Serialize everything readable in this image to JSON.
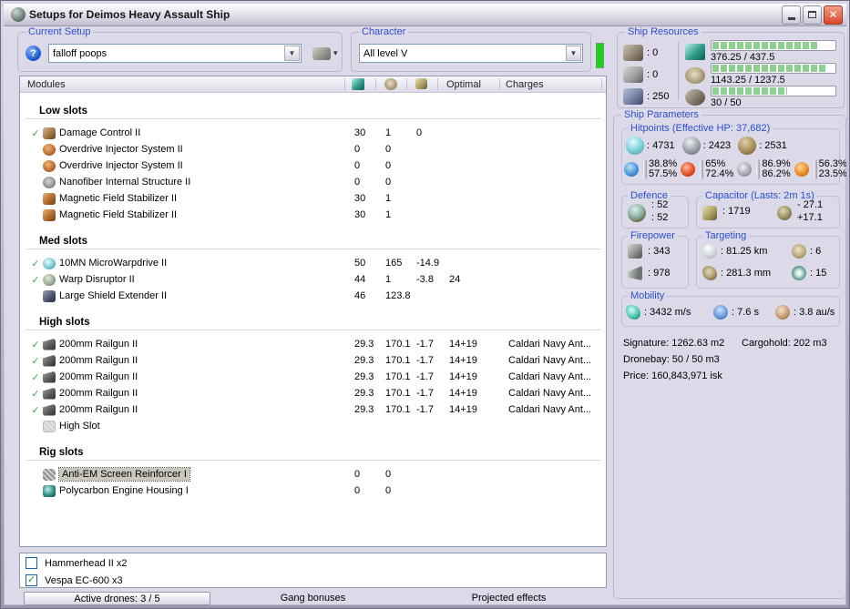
{
  "window": {
    "title": "Setups for Deimos Heavy Assault Ship"
  },
  "current_setup": {
    "label": "Current Setup",
    "value": "falloff poops"
  },
  "character": {
    "label": "Character",
    "value": "All level V"
  },
  "ship_resources": {
    "label": "Ship Resources",
    "turrets": ": 0",
    "launchers": ": 0",
    "calibration": ": 250",
    "cpu": {
      "text": "376.25 / 437.5",
      "pct": 86
    },
    "powergrid": {
      "text": "1143.25 / 1237.5",
      "pct": 92
    },
    "drones": {
      "text": "30 / 50",
      "pct": 60
    }
  },
  "modules_header": {
    "modules": "Modules",
    "optimal": "Optimal",
    "charges": "Charges"
  },
  "modules": {
    "sections": [
      {
        "title": "Low slots",
        "rows": [
          {
            "ck": "✓",
            "nm": "Damage Control II",
            "c1": "30",
            "c2": "1",
            "c3": "0",
            "c4": "",
            "c5": ""
          },
          {
            "ck": "",
            "nm": "Overdrive Injector System II",
            "c1": "0",
            "c2": "0",
            "c3": "",
            "c4": "",
            "c5": ""
          },
          {
            "ck": "",
            "nm": "Overdrive Injector System II",
            "c1": "0",
            "c2": "0",
            "c3": "",
            "c4": "",
            "c5": ""
          },
          {
            "ck": "",
            "nm": "Nanofiber Internal Structure II",
            "c1": "0",
            "c2": "0",
            "c3": "",
            "c4": "",
            "c5": ""
          },
          {
            "ck": "",
            "nm": "Magnetic Field Stabilizer II",
            "c1": "30",
            "c2": "1",
            "c3": "",
            "c4": "",
            "c5": ""
          },
          {
            "ck": "",
            "nm": "Magnetic Field Stabilizer II",
            "c1": "30",
            "c2": "1",
            "c3": "",
            "c4": "",
            "c5": ""
          }
        ]
      },
      {
        "title": "Med slots",
        "rows": [
          {
            "ck": "✓",
            "nm": "10MN MicroWarpdrive II",
            "c1": "50",
            "c2": "165",
            "c3": "-14.9",
            "c4": "",
            "c5": ""
          },
          {
            "ck": "✓",
            "nm": "Warp Disruptor II",
            "c1": "44",
            "c2": "1",
            "c3": "-3.8",
            "c4": "24",
            "c5": ""
          },
          {
            "ck": "",
            "nm": "Large Shield Extender II",
            "c1": "46",
            "c2": "123.8",
            "c3": "",
            "c4": "",
            "c5": ""
          }
        ]
      },
      {
        "title": "High slots",
        "rows": [
          {
            "ck": "✓",
            "nm": "200mm Railgun II",
            "c1": "29.3",
            "c2": "170.1",
            "c3": "-1.7",
            "c4": "14+19",
            "c5": "Caldari Navy Ant..."
          },
          {
            "ck": "✓",
            "nm": "200mm Railgun II",
            "c1": "29.3",
            "c2": "170.1",
            "c3": "-1.7",
            "c4": "14+19",
            "c5": "Caldari Navy Ant..."
          },
          {
            "ck": "✓",
            "nm": "200mm Railgun II",
            "c1": "29.3",
            "c2": "170.1",
            "c3": "-1.7",
            "c4": "14+19",
            "c5": "Caldari Navy Ant..."
          },
          {
            "ck": "✓",
            "nm": "200mm Railgun II",
            "c1": "29.3",
            "c2": "170.1",
            "c3": "-1.7",
            "c4": "14+19",
            "c5": "Caldari Navy Ant..."
          },
          {
            "ck": "✓",
            "nm": "200mm Railgun II",
            "c1": "29.3",
            "c2": "170.1",
            "c3": "-1.7",
            "c4": "14+19",
            "c5": "Caldari Navy Ant..."
          },
          {
            "ck": "",
            "nm": "High Slot",
            "c1": "",
            "c2": "",
            "c3": "",
            "c4": "",
            "c5": ""
          }
        ]
      },
      {
        "title": "Rig slots",
        "rows": [
          {
            "ck": "",
            "nm": "Anti-EM Screen Reinforcer I",
            "c1": "0",
            "c2": "0",
            "c3": "",
            "c4": "",
            "c5": ""
          },
          {
            "ck": "",
            "nm": "Polycarbon Engine Housing I",
            "c1": "0",
            "c2": "0",
            "c3": "",
            "c4": "",
            "c5": ""
          }
        ]
      }
    ]
  },
  "drones": [
    {
      "check": "",
      "label": "Hammerhead II x2"
    },
    {
      "check": "✓",
      "label": "Vespa EC-600 x3"
    }
  ],
  "bottom_bar": {
    "active_drones": "Active drones: 3 / 5",
    "gang_bonuses": "Gang bonuses",
    "projected_effects": "Projected effects"
  },
  "ship_parameters": {
    "label": "Ship Parameters",
    "hitpoints": {
      "label": "Hitpoints (Effective HP: 37,682)",
      "shield": ": 4731",
      "armor": ": 2423",
      "structure": ": 2531",
      "resists": [
        {
          "name": "em",
          "top": "38.8%",
          "bottom": "57.5%"
        },
        {
          "name": "thermal",
          "top": "65%",
          "bottom": "72.4%"
        },
        {
          "name": "kinetic",
          "top": "86.9%",
          "bottom": "86.2%"
        },
        {
          "name": "explosive",
          "top": "56.3%",
          "bottom": "23.5%"
        }
      ]
    },
    "defence": {
      "label": "Defence",
      "v1": ": 52",
      "v2": ": 52"
    },
    "capacitor": {
      "label": "Capacitor (Lasts: 2m 1s)",
      "amount": ": 1719",
      "drain": "- 27.1",
      "recharge": "+17.1"
    },
    "firepower": {
      "label": "Firepower",
      "volley": ": 343",
      "dps": ": 978"
    },
    "targeting": {
      "label": "Targeting",
      "range": ": 81.25 km",
      "scan_res": ": 281.3 mm",
      "max_targets": ": 6",
      "sensor_strength": ": 15"
    },
    "mobility": {
      "label": "Mobility",
      "speed": ": 3432 m/s",
      "align": ": 7.6 s",
      "warp": ": 3.8 au/s"
    },
    "stats": {
      "signature": "Signature: 1262.63 m2",
      "cargohold": "Cargohold: 202 m3",
      "dronebay": "Dronebay: 50 / 50 m3",
      "price": "Price: 160,843,971 isk"
    }
  }
}
